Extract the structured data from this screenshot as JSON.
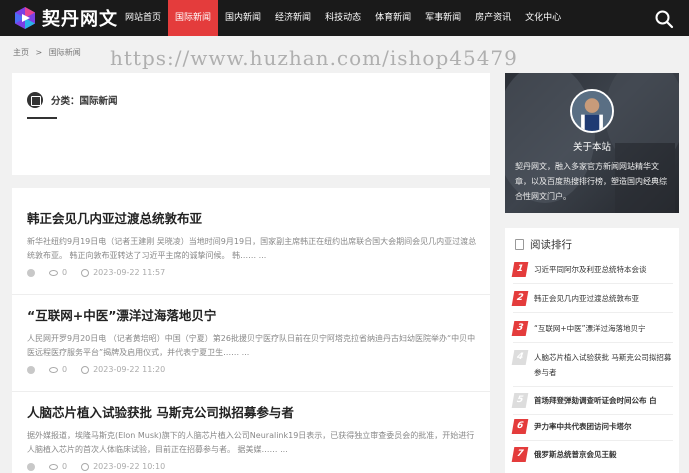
{
  "site": {
    "name": "契丹网文"
  },
  "nav": [
    {
      "label": "网站首页",
      "active": false
    },
    {
      "label": "国际新闻",
      "active": true
    },
    {
      "label": "国内新闻",
      "active": false
    },
    {
      "label": "经济新闻",
      "active": false
    },
    {
      "label": "科技动态",
      "active": false
    },
    {
      "label": "体育新闻",
      "active": false
    },
    {
      "label": "军事新闻",
      "active": false
    },
    {
      "label": "房产资讯",
      "active": false
    },
    {
      "label": "文化中心",
      "active": false
    }
  ],
  "breadcrumb": {
    "home": "主页",
    "separator": ">",
    "current": "国际新闻"
  },
  "watermark": "https://www.huzhan.com/ishop45479",
  "category": {
    "title": "分类：国际新闻"
  },
  "articles": [
    {
      "title": "韩正会见几内亚过渡总统敦布亚",
      "excerpt": "新华社纽约9月19日电（记者王建刚 吴晓凌）当地时间9月19日，国家副主席韩正在纽约出席联合国大会期间会见几内亚过渡总统敦布亚。 韩正向敦布亚转达了习近平主席的诚挚问候。 韩…… ...",
      "views": "0",
      "date": "2023-09-22 11:57"
    },
    {
      "title": "“互联网+中医”漂洋过海落地贝宁",
      "excerpt": "人民网开罗9月20日电 （记者黄培昭）中国（宁夏）第26批援贝宁医疗队日前在贝宁阿塔克拉省纳迪丹古妇幼医院举办“中贝中医远程医疗服务平台”揭牌及启用仪式，并代表宁夏卫生…… ...",
      "views": "0",
      "date": "2023-09-22 11:20"
    },
    {
      "title": "人脑芯片植入试验获批 马斯克公司拟招募参与者",
      "excerpt": "据外媒报道，埃隆马斯克(Elon Musk)旗下的人脑芯片植入公司Neuralink19日表示，已获得独立审查委员会的批准，开始进行人脑植入芯片的首次人体临床试验，目前正在招募参与者。 据美媒…… ...",
      "views": "0",
      "date": "2023-09-22 10:10"
    }
  ],
  "about": {
    "title": "关于本站",
    "description": "契丹网文，融入多家官方新闻网站精华文章，以及百度热搜排行榜，塑造国内经典综合性网文门户。"
  },
  "ranking": {
    "title": "阅读排行",
    "items": [
      {
        "num": "1",
        "text": "习近平同阿尔及利亚总统特本会谈"
      },
      {
        "num": "2",
        "text": "韩正会见几内亚过渡总统敦布亚"
      },
      {
        "num": "3",
        "text": "“互联网+中医”漂洋过海落地贝宁"
      },
      {
        "num": "4",
        "text": "人脑芯片植入试验获批 马斯克公司拟招募参与者"
      },
      {
        "num": "5",
        "text": "首场拜登弹劾调查听证会时间公布 白"
      },
      {
        "num": "6",
        "text": "尹力率中共代表团访问卡塔尔"
      },
      {
        "num": "7",
        "text": "俄罗斯总统普京会见王毅"
      }
    ]
  },
  "colors": {
    "accent": "#e43c3c",
    "header": "#1a1a1a"
  }
}
